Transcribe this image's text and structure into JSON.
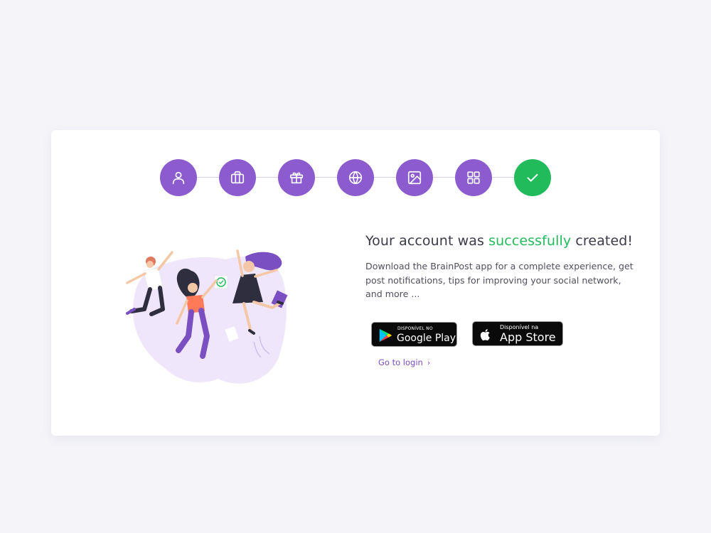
{
  "stepper": {
    "steps": [
      {
        "icon": "user-icon",
        "status": "completed"
      },
      {
        "icon": "briefcase-icon",
        "status": "completed"
      },
      {
        "icon": "gift-icon",
        "status": "completed"
      },
      {
        "icon": "globe-icon",
        "status": "completed"
      },
      {
        "icon": "image-icon",
        "status": "completed"
      },
      {
        "icon": "grid-icon",
        "status": "completed"
      },
      {
        "icon": "check-icon",
        "status": "current"
      }
    ]
  },
  "success": {
    "title_prefix": "Your account was ",
    "title_highlight": "successfully",
    "title_suffix": " created!",
    "description": "Download the BrainPost app for a complete experience, get post notifications, tips for improving your social network, and more ..."
  },
  "stores": {
    "google_play": {
      "small": "DISPONÍVEL NO",
      "big": "Google Play"
    },
    "app_store": {
      "small": "Disponível na",
      "big": "App Store"
    }
  },
  "login_link": {
    "label": "Go to login",
    "chevron": "›"
  },
  "colors": {
    "background": "#f4f4f9",
    "accent_purple": "#8c5ccf",
    "success_green": "#21bb5c",
    "text_dark": "#3a3a48",
    "link": "#7a4fc2"
  }
}
